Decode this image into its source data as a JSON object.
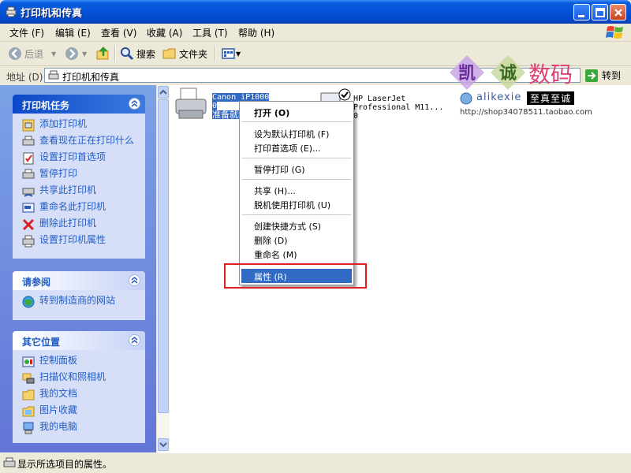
{
  "window": {
    "title": "打印机和传真"
  },
  "menubar": {
    "items": [
      "文件 (F)",
      "编辑 (E)",
      "查看 (V)",
      "收藏 (A)",
      "工具 (T)",
      "帮助 (H)"
    ]
  },
  "toolbar": {
    "back_label": "后退",
    "search_label": "搜索",
    "folders_label": "文件夹"
  },
  "address": {
    "label": "地址 (D)",
    "value": "打印机和传真",
    "go_label": "转到"
  },
  "tasks": {
    "printer_tasks": {
      "title": "打印机任务",
      "items": [
        "添加打印机",
        "查看现在正在打印什么",
        "设置打印首选项",
        "暂停打印",
        "共享此打印机",
        "重命名此打印机",
        "删除此打印机",
        "设置打印机属性"
      ]
    },
    "see_also": {
      "title": "请参阅",
      "items": [
        "转到制造商的网站"
      ]
    },
    "other_places": {
      "title": "其它位置",
      "items": [
        "控制面板",
        "扫描仪和照相机",
        "我的文档",
        "图片收藏",
        "我的电脑"
      ]
    }
  },
  "printers": [
    {
      "name": "Canon iP1000",
      "docs": "0",
      "status": "准备就绪"
    },
    {
      "name": "HP LaserJet",
      "name2": "Professional M11...",
      "docs": "0"
    }
  ],
  "context_menu": {
    "items": [
      "打开 (O)",
      "设为默认打印机 (F)",
      "打印首选项 (E)...",
      "暂停打印 (G)",
      "共享 (H)...",
      "脱机使用打印机 (U)",
      "创建快捷方式 (S)",
      "删除 (D)",
      "重命名 (M)",
      "属性 (R)"
    ]
  },
  "watermark": {
    "big_chars": [
      "凯",
      "诚",
      "数码"
    ],
    "brand": "alikexie",
    "slogan": "至真至诚",
    "url": "http://shop34078511.taobao.com"
  },
  "statusbar": {
    "text": "显示所选项目的属性。"
  },
  "colors": {
    "accent": "#316ac5",
    "title_blue": "#0553d8",
    "highlight_red": "#e02020"
  }
}
